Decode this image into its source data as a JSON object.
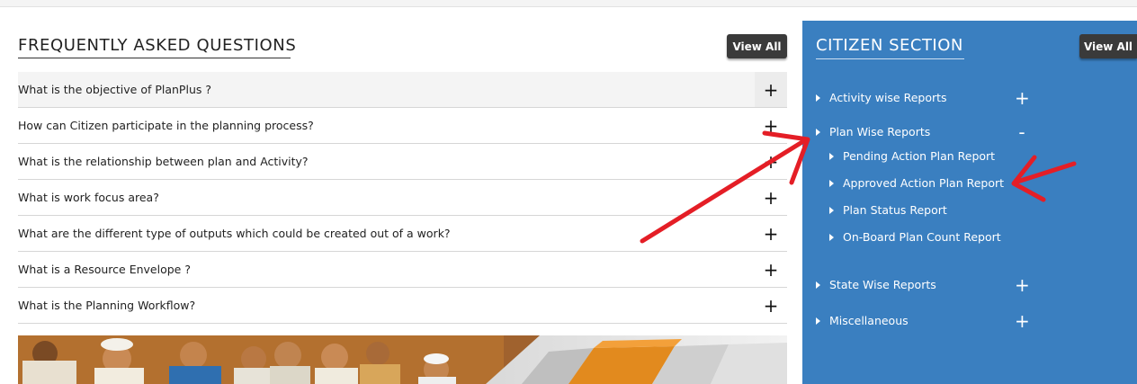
{
  "faq": {
    "title": "FREQUENTLY ASKED QUESTIONS",
    "view_all": "View All",
    "questions": [
      {
        "text": "What is the objective of PlanPlus ?",
        "toggle": "+"
      },
      {
        "text": "How can Citizen participate in the planning process?",
        "toggle": "+"
      },
      {
        "text": "What is the relationship between plan and Activity?",
        "toggle": "+"
      },
      {
        "text": "What is work focus area?",
        "toggle": "+"
      },
      {
        "text": "What are the different type of outputs which could be created out of a work?",
        "toggle": "+"
      },
      {
        "text": "What is a Resource Envelope ?",
        "toggle": "+"
      },
      {
        "text": "What is the Planning Workflow?",
        "toggle": "+"
      }
    ]
  },
  "citizen": {
    "title": "CITIZEN SECTION",
    "view_all": "View All",
    "sections": [
      {
        "label": "Activity wise Reports",
        "toggle": "+"
      },
      {
        "label": "Plan Wise Reports",
        "toggle": "-"
      },
      {
        "label": "State Wise Reports",
        "toggle": "+"
      },
      {
        "label": "Miscellaneous",
        "toggle": "+"
      }
    ],
    "plan_wise_items": [
      {
        "label": "Pending Action Plan Report"
      },
      {
        "label": "Approved Action Plan Report"
      },
      {
        "label": "Plan Status Report"
      },
      {
        "label": "On-Board Plan Count Report"
      }
    ],
    "panel_color": "#3a7fc0"
  },
  "annotation": {
    "arrow_color": "#e41e26"
  }
}
